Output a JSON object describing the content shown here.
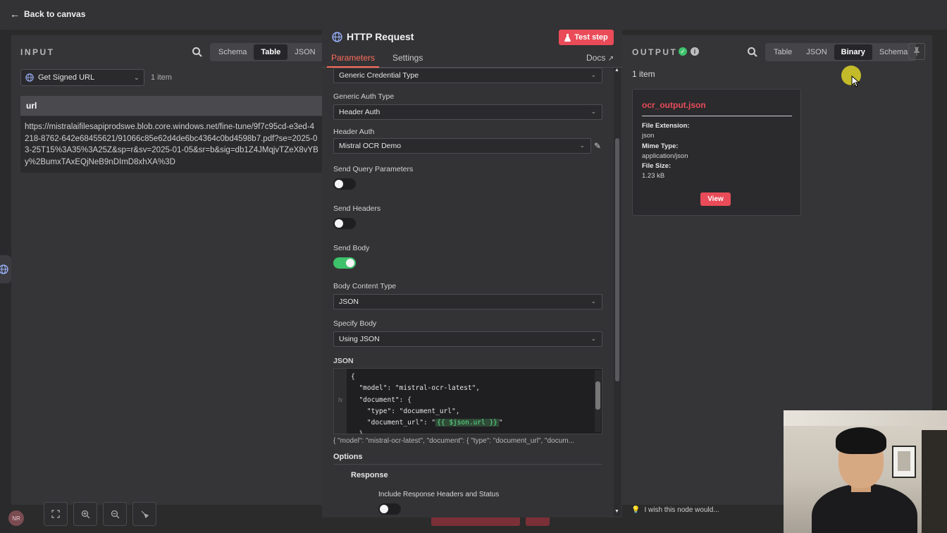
{
  "topbar": {
    "back_label": "Back to canvas"
  },
  "input": {
    "title": "INPUT",
    "tabs": [
      "Schema",
      "Table",
      "JSON"
    ],
    "active_tab": "Table",
    "node_select": "Get Signed URL",
    "item_count": "1 item",
    "column_header": "url",
    "url_value": "https://mistralaifilesapiprodswe.blob.core.windows.net/fine-tune/9f7c95cd-e3ed-4218-8762-642e68455621/91066c85e62d4de6bc4364c0bd4598b7.pdf?se=2025-03-25T15%3A35%3A25Z&sp=r&sv=2025-01-05&sr=b&sig=db1Z4JMqjvTZeX8vYBy%2BumxTAxEQjNeB9nDImD8xhXA%3D"
  },
  "http": {
    "title": "HTTP Request",
    "test_step": "Test step",
    "tabs": {
      "parameters": "Parameters",
      "settings": "Settings",
      "docs": "Docs"
    },
    "credential_type": "Generic Credential Type",
    "generic_auth_label": "Generic Auth Type",
    "generic_auth_value": "Header Auth",
    "header_auth_label": "Header Auth",
    "header_auth_value": "Mistral OCR Demo",
    "send_query_label": "Send Query Parameters",
    "send_query_on": false,
    "send_headers_label": "Send Headers",
    "send_headers_on": false,
    "send_body_label": "Send Body",
    "send_body_on": true,
    "body_content_label": "Body Content Type",
    "body_content_value": "JSON",
    "specify_body_label": "Specify Body",
    "specify_body_value": "Using JSON",
    "json_label": "JSON",
    "json_gutter": "fx",
    "json_lines": {
      "l1": "{",
      "l2": "  \"model\": \"mistral-ocr-latest\",",
      "l3": "  \"document\": {",
      "l4": "    \"type\": \"document_url\",",
      "l5_pre": "    \"document_url\": \"",
      "l5_expr": "{{ $json.url }}",
      "l5_post": "\"",
      "l6": "  }"
    },
    "json_preview": "{   \"model\": \"mistral-ocr-latest\",   \"document\": {     \"type\": \"document_url\",     \"docum...",
    "options_label": "Options",
    "response_label": "Response",
    "include_response_label": "Include Response Headers and Status",
    "include_response_on": false
  },
  "output": {
    "title": "OUTPUT",
    "tabs": [
      "Table",
      "JSON",
      "Binary",
      "Schema"
    ],
    "active_tab": "Binary",
    "item_count": "1 item",
    "file_name": "ocr_output.json",
    "file_extension_label": "File Extension:",
    "file_extension_value": "json",
    "mime_type_label": "Mime Type:",
    "mime_type_value": "application/json",
    "file_size_label": "File Size:",
    "file_size_value": "1.23 kB",
    "view_label": "View",
    "wish_text": "I wish this node would..."
  },
  "footer": {
    "avatar_initials": "NR"
  },
  "colors": {
    "accent": "#ea4b58",
    "toggle_on": "#3ec16b",
    "success": "#3ec16b"
  }
}
